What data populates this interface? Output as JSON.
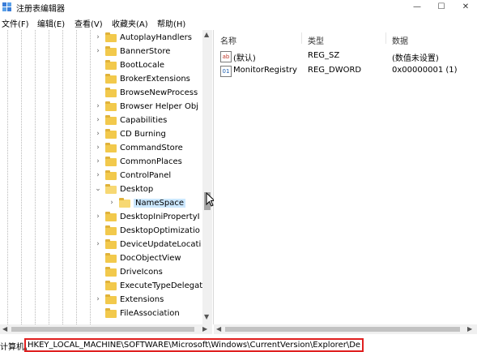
{
  "window": {
    "title": "注册表编辑器",
    "controls": {
      "minimize": "—",
      "maximize": "☐",
      "close": "✕"
    }
  },
  "menu": [
    "文件(F)",
    "编辑(E)",
    "查看(V)",
    "收藏夹(A)",
    "帮助(H)"
  ],
  "tree": {
    "items": [
      {
        "label": "AutoplayHandlers",
        "expandable": true
      },
      {
        "label": "BannerStore",
        "expandable": true
      },
      {
        "label": "BootLocale",
        "expandable": false
      },
      {
        "label": "BrokerExtensions",
        "expandable": false
      },
      {
        "label": "BrowseNewProcess",
        "expandable": false
      },
      {
        "label": "Browser Helper Obj",
        "expandable": true
      },
      {
        "label": "Capabilities",
        "expandable": true
      },
      {
        "label": "CD Burning",
        "expandable": true
      },
      {
        "label": "CommandStore",
        "expandable": true
      },
      {
        "label": "CommonPlaces",
        "expandable": true
      },
      {
        "label": "ControlPanel",
        "expandable": true
      },
      {
        "label": "Desktop",
        "expandable": true,
        "expanded": true
      },
      {
        "label": "NameSpace",
        "expandable": true,
        "child": true,
        "selected": true
      },
      {
        "label": "DesktopIniPropertyI",
        "expandable": true
      },
      {
        "label": "DesktopOptimizatio",
        "expandable": false
      },
      {
        "label": "DeviceUpdateLocati",
        "expandable": true
      },
      {
        "label": "DocObjectView",
        "expandable": false
      },
      {
        "label": "DriveIcons",
        "expandable": false
      },
      {
        "label": "ExecuteTypeDelegat",
        "expandable": false
      },
      {
        "label": "Extensions",
        "expandable": true
      },
      {
        "label": "FileAssociation",
        "expandable": false
      }
    ]
  },
  "values": {
    "headers": {
      "name": "名称",
      "type": "类型",
      "data": "数据"
    },
    "rows": [
      {
        "icon": "ab",
        "name": "(默认)",
        "type": "REG_SZ",
        "data": "(数值未设置)"
      },
      {
        "icon": "bin",
        "name": "MonitorRegistry",
        "type": "REG_DWORD",
        "data": "0x00000001 (1)"
      }
    ]
  },
  "status": {
    "prefix": "计算机\\",
    "path": "HKEY_LOCAL_MACHINE\\SOFTWARE\\Microsoft\\Windows\\CurrentVersion\\Explorer\\De"
  },
  "colors": {
    "folder": "#f2c94c",
    "selection": "#cce8ff",
    "highlight_border": "#e02020"
  }
}
